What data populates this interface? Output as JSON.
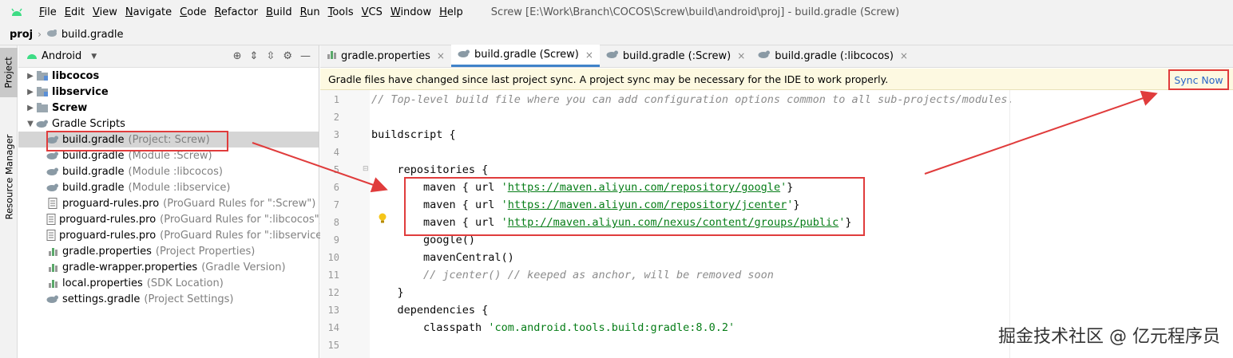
{
  "menubar": {
    "items": [
      {
        "label": "File",
        "mnemonic": "F",
        "rest": "ile"
      },
      {
        "label": "Edit",
        "mnemonic": "E",
        "rest": "dit"
      },
      {
        "label": "View",
        "mnemonic": "V",
        "rest": "iew"
      },
      {
        "label": "Navigate",
        "mnemonic": "N",
        "rest": "avigate"
      },
      {
        "label": "Code",
        "mnemonic": "C",
        "rest": "ode"
      },
      {
        "label": "Refactor",
        "mnemonic": "R",
        "rest": "efactor"
      },
      {
        "label": "Build",
        "mnemonic": "B",
        "rest": "uild"
      },
      {
        "label": "Run",
        "mnemonic": "R",
        "rest": "un"
      },
      {
        "label": "Tools",
        "mnemonic": "T",
        "rest": "ools"
      },
      {
        "label": "VCS",
        "mnemonic": "V",
        "rest": "CS"
      },
      {
        "label": "Window",
        "mnemonic": "W",
        "rest": "indow"
      },
      {
        "label": "Help",
        "mnemonic": "H",
        "rest": "elp"
      }
    ],
    "window_title": "Screw [E:\\Work\\Branch\\COCOS\\Screw\\build\\android\\proj] - build.gradle (Screw)"
  },
  "breadcrumb": {
    "project": "proj",
    "file": "build.gradle"
  },
  "toolstrip": {
    "project_label": "Project",
    "resource_label": "Resource Manager"
  },
  "project_panel": {
    "view_label": "Android",
    "tree": [
      {
        "label": "libcocos",
        "hint": "",
        "bold": true,
        "indent": 0,
        "arrow": "▶",
        "icon": "module-folder-icon",
        "selected": false
      },
      {
        "label": "libservice",
        "hint": "",
        "bold": true,
        "indent": 0,
        "arrow": "▶",
        "icon": "module-folder-icon",
        "selected": false
      },
      {
        "label": "Screw",
        "hint": "",
        "bold": true,
        "indent": 0,
        "arrow": "▶",
        "icon": "folder-icon",
        "selected": false
      },
      {
        "label": "Gradle Scripts",
        "hint": "",
        "bold": false,
        "indent": 0,
        "arrow": "▼",
        "icon": "gradle-icon",
        "selected": false
      },
      {
        "label": "build.gradle",
        "hint": "(Project: Screw)",
        "bold": false,
        "indent": 1,
        "arrow": "",
        "icon": "gradle-icon",
        "selected": true
      },
      {
        "label": "build.gradle",
        "hint": "(Module :Screw)",
        "bold": false,
        "indent": 1,
        "arrow": "",
        "icon": "gradle-icon",
        "selected": false
      },
      {
        "label": "build.gradle",
        "hint": "(Module :libcocos)",
        "bold": false,
        "indent": 1,
        "arrow": "",
        "icon": "gradle-icon",
        "selected": false
      },
      {
        "label": "build.gradle",
        "hint": "(Module :libservice)",
        "bold": false,
        "indent": 1,
        "arrow": "",
        "icon": "gradle-icon",
        "selected": false
      },
      {
        "label": "proguard-rules.pro",
        "hint": "(ProGuard Rules for \":Screw\")",
        "bold": false,
        "indent": 1,
        "arrow": "",
        "icon": "text-file-icon",
        "selected": false
      },
      {
        "label": "proguard-rules.pro",
        "hint": "(ProGuard Rules for \":libcocos\")",
        "bold": false,
        "indent": 1,
        "arrow": "",
        "icon": "text-file-icon",
        "selected": false
      },
      {
        "label": "proguard-rules.pro",
        "hint": "(ProGuard Rules for \":libservice\")",
        "bold": false,
        "indent": 1,
        "arrow": "",
        "icon": "text-file-icon",
        "selected": false
      },
      {
        "label": "gradle.properties",
        "hint": "(Project Properties)",
        "bold": false,
        "indent": 1,
        "arrow": "",
        "icon": "properties-icon",
        "selected": false
      },
      {
        "label": "gradle-wrapper.properties",
        "hint": "(Gradle Version)",
        "bold": false,
        "indent": 1,
        "arrow": "",
        "icon": "properties-icon",
        "selected": false
      },
      {
        "label": "local.properties",
        "hint": "(SDK Location)",
        "bold": false,
        "indent": 1,
        "arrow": "",
        "icon": "properties-icon",
        "selected": false
      },
      {
        "label": "settings.gradle",
        "hint": "(Project Settings)",
        "bold": false,
        "indent": 1,
        "arrow": "",
        "icon": "gradle-icon",
        "selected": false
      }
    ]
  },
  "editor_tabs": [
    {
      "label": "gradle.properties",
      "icon": "properties-icon",
      "active": false
    },
    {
      "label": "build.gradle (Screw)",
      "icon": "gradle-icon",
      "active": true
    },
    {
      "label": "build.gradle (:Screw)",
      "icon": "gradle-icon",
      "active": false
    },
    {
      "label": "build.gradle (:libcocos)",
      "icon": "gradle-icon",
      "active": false
    }
  ],
  "notification": {
    "message": "Gradle files have changed since last project sync. A project sync may be necessary for the IDE to work properly.",
    "action": "Sync Now"
  },
  "editor": {
    "line_numbers": [
      "1",
      "2",
      "3",
      "4",
      "5",
      "6",
      "7",
      "8",
      "9",
      "10",
      "11",
      "12",
      "13",
      "14",
      "15"
    ],
    "lines": [
      [
        {
          "t": "// Top-level build file where you can add configuration options common to all sub-projects/modules.",
          "c": "cm"
        }
      ],
      [],
      [
        {
          "t": "buildscript {",
          "c": ""
        }
      ],
      [],
      [
        {
          "t": "    repositories {",
          "c": ""
        }
      ],
      [
        {
          "t": "        maven { url ",
          "c": ""
        },
        {
          "t": "'",
          "c": "str"
        },
        {
          "t": "https://maven.aliyun.com/repository/google",
          "c": "url"
        },
        {
          "t": "'",
          "c": "str"
        },
        {
          "t": "}",
          "c": ""
        }
      ],
      [
        {
          "t": "        maven { url ",
          "c": ""
        },
        {
          "t": "'",
          "c": "str"
        },
        {
          "t": "https://maven.aliyun.com/repository/jcenter",
          "c": "url"
        },
        {
          "t": "'",
          "c": "str"
        },
        {
          "t": "}",
          "c": ""
        }
      ],
      [
        {
          "t": "        maven { url ",
          "c": ""
        },
        {
          "t": "'",
          "c": "str"
        },
        {
          "t": "http://maven.aliyun.com/nexus/content/groups/public",
          "c": "url"
        },
        {
          "t": "'",
          "c": "str"
        },
        {
          "t": "}",
          "c": ""
        }
      ],
      [
        {
          "t": "        google()",
          "c": ""
        }
      ],
      [
        {
          "t": "        mavenCentral()",
          "c": ""
        }
      ],
      [
        {
          "t": "        // jcenter() // keeped as anchor, will be removed soon",
          "c": "cm"
        }
      ],
      [
        {
          "t": "    }",
          "c": ""
        }
      ],
      [
        {
          "t": "    dependencies {",
          "c": ""
        }
      ],
      [
        {
          "t": "        classpath ",
          "c": ""
        },
        {
          "t": "'com.android.tools.build:gradle:8.0.2'",
          "c": "str"
        }
      ],
      []
    ]
  },
  "watermark": "掘金技术社区 @ 亿元程序员",
  "colors": {
    "accent": "#4083c9",
    "highlight_box": "#e03c3c",
    "notification_bg": "#fdf9e1",
    "link": "#2a66c7"
  }
}
